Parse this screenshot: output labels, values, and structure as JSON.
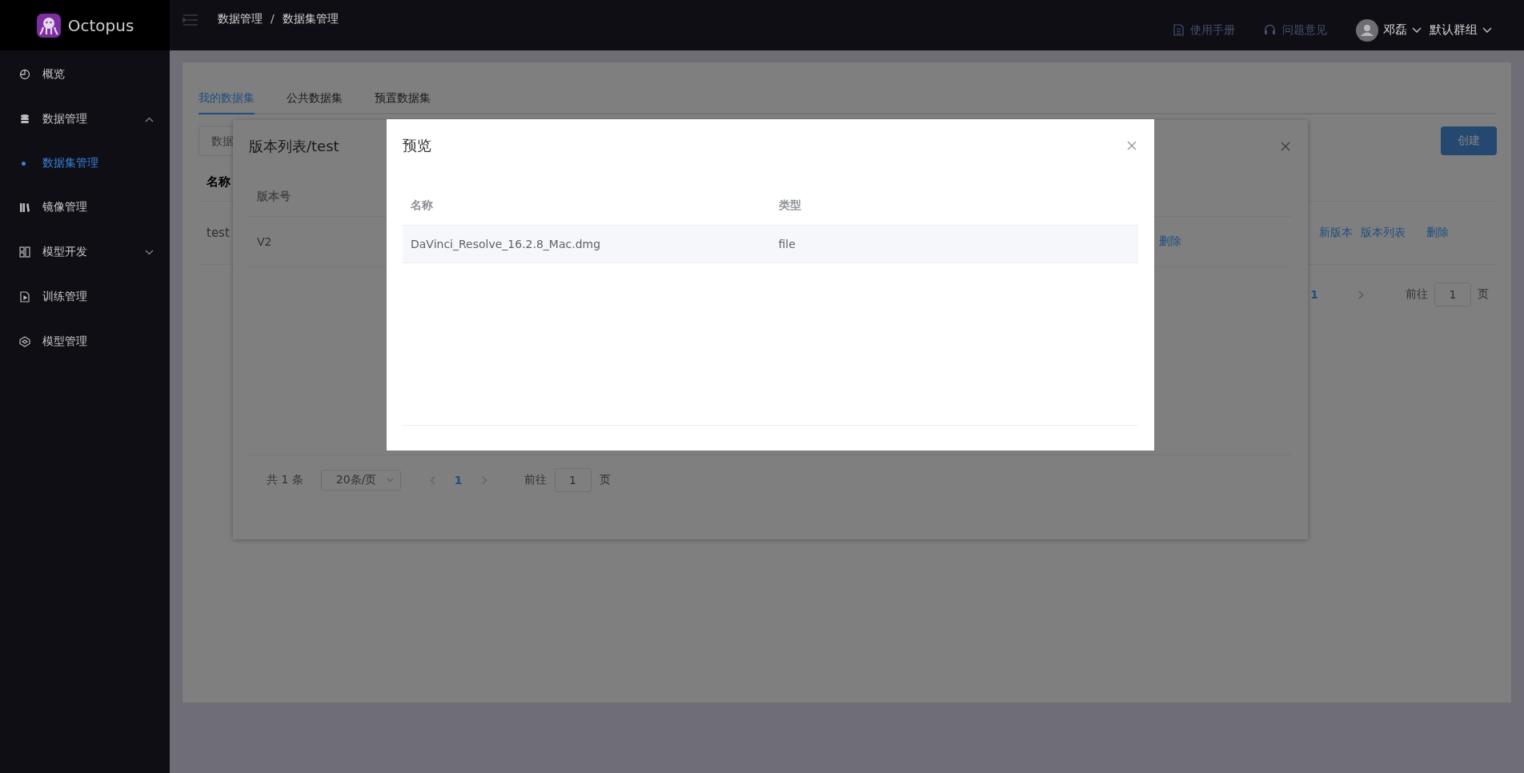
{
  "app": {
    "logo_text": "Octopus"
  },
  "sidebar": {
    "items": [
      {
        "label": "概览",
        "kind": "link",
        "selected": false
      },
      {
        "label": "数据管理",
        "kind": "group",
        "expanded": true,
        "selected": false,
        "children": [
          {
            "label": "数据集管理",
            "selected": true
          }
        ]
      },
      {
        "label": "镜像管理",
        "kind": "link",
        "selected": false
      },
      {
        "label": "模型开发",
        "kind": "group",
        "expanded": false,
        "selected": false
      },
      {
        "label": "训练管理",
        "kind": "link",
        "selected": false
      },
      {
        "label": "模型管理",
        "kind": "link",
        "selected": false
      }
    ]
  },
  "topbar": {
    "breadcrumb": [
      "数据管理",
      "数据集管理"
    ],
    "separator": "/",
    "links": [
      {
        "label": "使用手册"
      },
      {
        "label": "问题意见"
      }
    ],
    "user": "邓磊",
    "group": "默认群组"
  },
  "page": {
    "tabs": [
      {
        "label": "我的数据集",
        "selected": true
      },
      {
        "label": "公共数据集",
        "selected": false
      },
      {
        "label": "预置数据集",
        "selected": false
      }
    ],
    "search": {
      "placeholder": "数据"
    },
    "create_button": "创建",
    "table": {
      "columns": [
        "名称"
      ],
      "rows": [
        {
          "name": "test",
          "actions": [
            "新版本",
            "版本列表",
            "删除"
          ]
        }
      ]
    },
    "pagination": {
      "page": "1",
      "goto_label": "前往",
      "goto_value": "1",
      "unit": "页"
    }
  },
  "version_dialog": {
    "title": "版本列表/test",
    "columns": [
      "版本号"
    ],
    "rows": [
      {
        "version": "V2",
        "actions": [
          "删除"
        ]
      }
    ],
    "pagination": {
      "total": "共 1 条",
      "page_size": "20条/页",
      "page": "1",
      "goto_label": "前往",
      "goto_value": "1",
      "unit": "页"
    }
  },
  "preview_dialog": {
    "title": "预览",
    "columns": [
      "名称",
      "类型"
    ],
    "rows": [
      {
        "name": "DaVinci_Resolve_16.2.8_Mac.dmg",
        "type": "file"
      }
    ]
  }
}
